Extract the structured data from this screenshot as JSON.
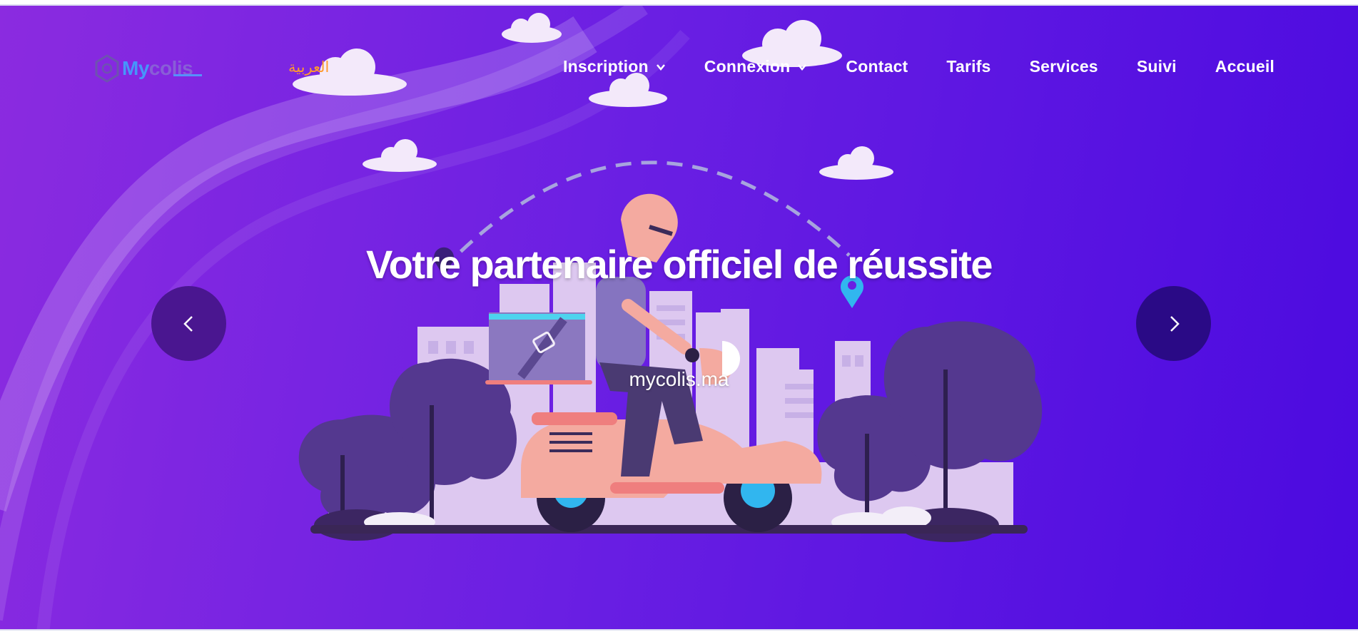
{
  "logo": {
    "part1": "My",
    "part2": "colis"
  },
  "lang_switch": {
    "label": "العربية"
  },
  "nav": {
    "items": [
      {
        "label": "Inscription",
        "dropdown": true
      },
      {
        "label": "Connexion",
        "dropdown": true
      },
      {
        "label": "Contact",
        "dropdown": false
      },
      {
        "label": "Tarifs",
        "dropdown": false
      },
      {
        "label": "Services",
        "dropdown": false
      },
      {
        "label": "Suivi",
        "dropdown": false
      },
      {
        "label": "Accueil",
        "dropdown": false
      }
    ]
  },
  "hero": {
    "title": "Votre partenaire officiel de réussite",
    "subtitle": "mycolis.ma"
  },
  "carousel": {
    "prev_icon": "chevron-left-icon",
    "next_icon": "chevron-right-icon"
  },
  "colors": {
    "gradient_start": "#8b2be0",
    "gradient_end": "#4b0ae0",
    "lang_link": "#ff9a2c",
    "prev_button": "#4a1690",
    "next_button": "#2a0a86"
  }
}
